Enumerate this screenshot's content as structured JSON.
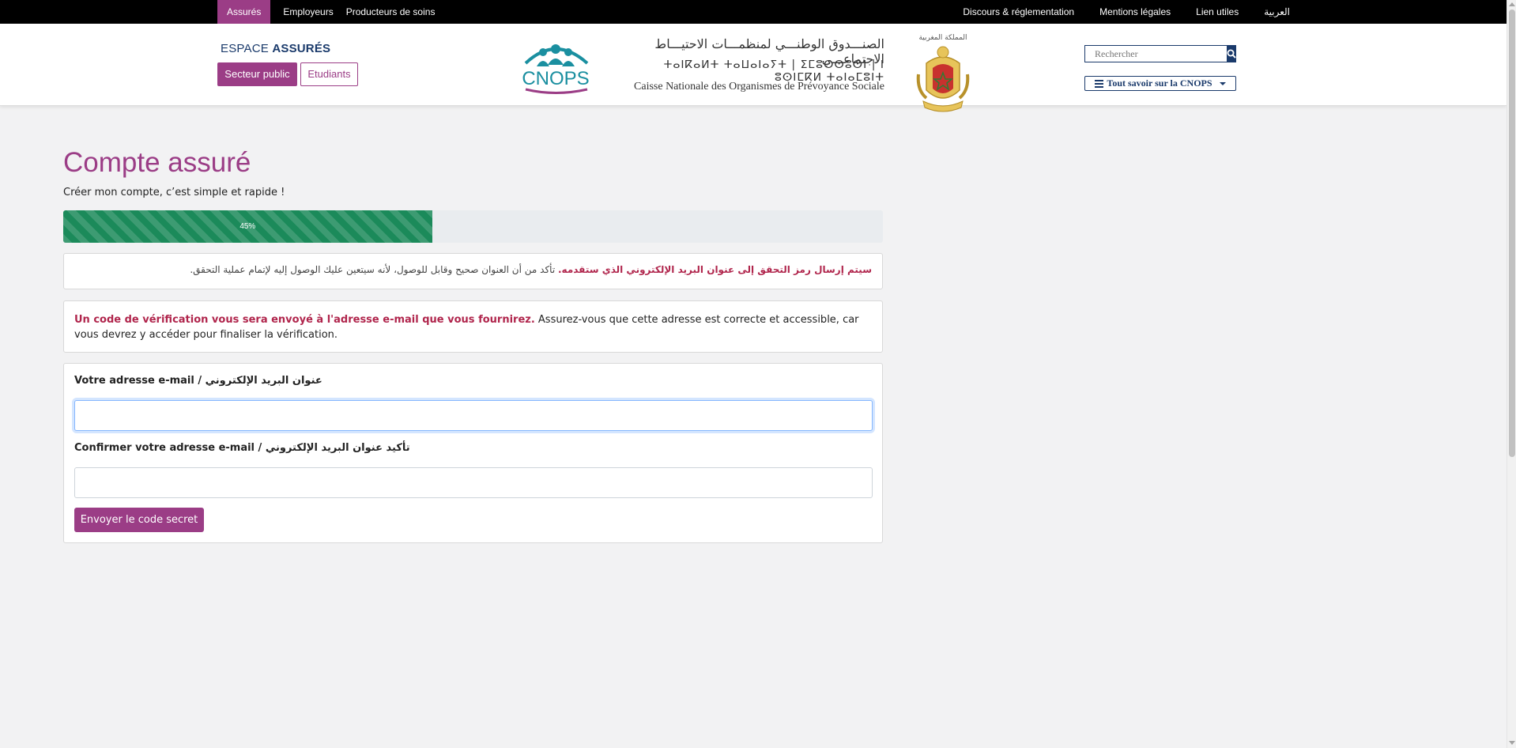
{
  "topnav": {
    "left": [
      {
        "label": "Assurés",
        "active": true
      },
      {
        "label": "Employeurs",
        "active": false
      },
      {
        "label": "Producteurs de soins",
        "active": false
      }
    ],
    "right": [
      {
        "label": "Discours & réglementation"
      },
      {
        "label": "Mentions légales"
      },
      {
        "label": "Lien utiles"
      },
      {
        "label": "العربية"
      }
    ]
  },
  "header": {
    "espace_prefix": "ESPACE",
    "espace_strong": "ASSURÉS",
    "btn_secteur": "Secteur public",
    "btn_etudiants": "Etudiants",
    "logo_name": "CNOPS",
    "logo_text_ar": "الصنـــدوق الوطنـــي لمنظمـــات الاحتيـــاط الاجتماعـــي",
    "logo_text_tif": "ⵜⴰⵏⴽⴰⵍⵜ ⵜⴰⵡⴰⵏⴰⵢⵜ | ⵉⵎⵓⵙⵙⵓⵙⵏ | ⵏ ⵓⵙⵏⵎⴽⵍ ⵜⴰⵏⴰⵎⵓⵏⵜ",
    "logo_text_fr": "Caisse Nationale des Organismes de Prévoyance Sociale",
    "royaume_label": "المملكة المغربية",
    "search_placeholder": "Rechercher",
    "dropdown_label": "Tout savoir sur la CNOPS"
  },
  "main": {
    "title": "Compte assuré",
    "subtitle": "Créer mon compte, c’est simple et rapide !",
    "progress": {
      "percent": 45,
      "label": "45%"
    },
    "notice_ar": {
      "bold": "سيتم إرسال رمز التحقق إلى عنوان البريد الإلكتروني الذي ستقدمه.",
      "rest": "تأكد من أن العنوان صحيح وقابل للوصول، لأنه سيتعين عليك الوصول إليه لإتمام عملية التحقق."
    },
    "notice_fr": {
      "bold": "Un code de vérification vous sera envoyé à l'adresse e-mail que vous fournirez.",
      "rest": "Assurez-vous que cette adresse est correcte et accessible, car vous devrez y accéder pour finaliser la vérification."
    },
    "form": {
      "email_label": "Votre adresse e-mail / عنوان البريد الإلكتروني",
      "email_value": "",
      "confirm_label": "Confirmer votre adresse e-mail / تأكيد عنوان البريد الإلكتروني",
      "confirm_value": "",
      "submit_label": "Envoyer le code secret"
    }
  },
  "colors": {
    "brand_purple": "#9b3d86",
    "navy": "#1a3a6b",
    "progress_green": "#1b8a5a",
    "alert_red": "#b0254c",
    "logo_teal": "#1a8fa0"
  },
  "icons": {
    "search": "search-icon",
    "menu": "hamburger-menu-icon",
    "dropdown": "caret-down-icon"
  }
}
